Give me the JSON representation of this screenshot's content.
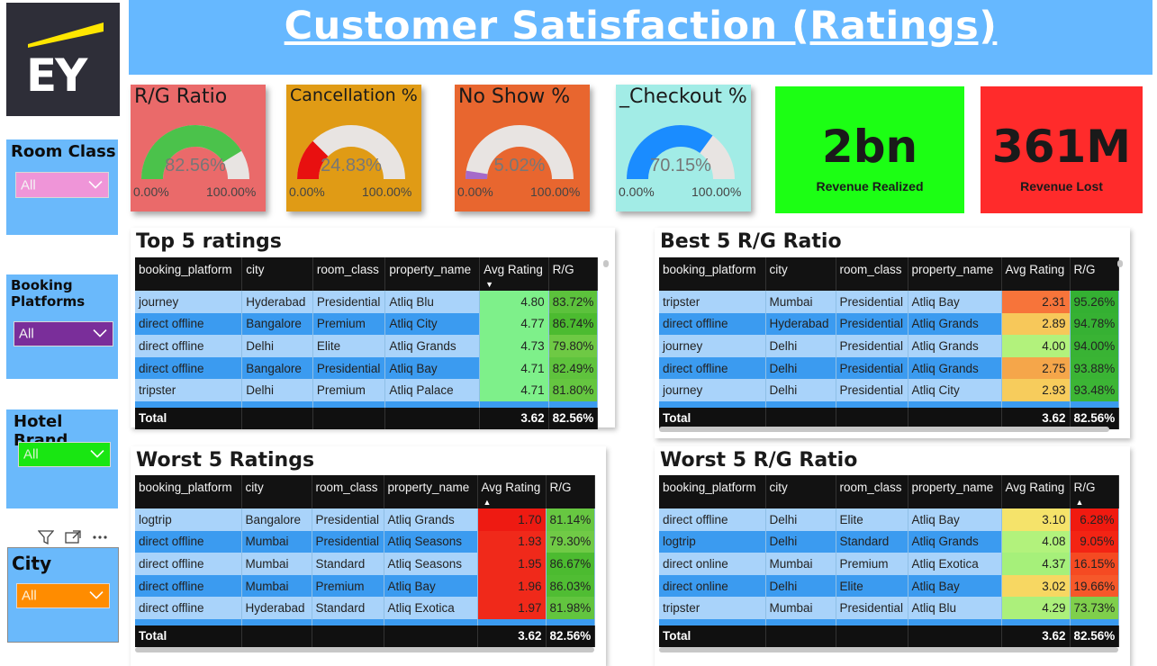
{
  "title": "Customer Satisfaction (Ratings)",
  "logo_text": "EY",
  "slicers": [
    {
      "title": "Room Class",
      "value": "All",
      "bg": "#ef95d8"
    },
    {
      "title": "Booking Platforms",
      "value": "All",
      "bg": "#7a2e9a"
    },
    {
      "title": "Hotel Brand",
      "value": "All",
      "bg": "#19e612"
    },
    {
      "title": "City",
      "value": "All",
      "bg": "#ff8c00"
    }
  ],
  "visual_header_icons": [
    "filter-icon",
    "focus-mode-icon",
    "more-options-icon"
  ],
  "kpis": [
    {
      "title": "R/G Ratio",
      "value": "82.56%",
      "fraction": 0.8256,
      "min": "0.00%",
      "max": "100.00%",
      "bg": "#ea6a6a",
      "fill": "#4bc24b"
    },
    {
      "title": "Cancellation %",
      "value": "24.83%",
      "fraction": 0.2483,
      "min": "0.00%",
      "max": "100.00%",
      "bg": "#e09b15",
      "fill": "#e81010"
    },
    {
      "title": "No Show %",
      "value": "5.02%",
      "fraction": 0.0502,
      "min": "0.00%",
      "max": "100.00%",
      "bg": "#e8662f",
      "fill": "#a56ac9"
    },
    {
      "title": "_Checkout %",
      "value": "70.15%",
      "fraction": 0.7015,
      "min": "0.00%",
      "max": "100.00%",
      "bg": "#a2ece6",
      "fill": "#1a8cff"
    }
  ],
  "cards": [
    {
      "value": "2bn",
      "label": "Revenue Realized",
      "bg": "#1cff14"
    },
    {
      "value": "361M",
      "label": "Revenue Lost",
      "bg": "#ff2b2b"
    }
  ],
  "columns": [
    "booking_platform",
    "city",
    "room_class",
    "property_name",
    "Avg Rating",
    "R/G"
  ],
  "tables": {
    "top5": {
      "title": "Top 5 ratings",
      "sort_col": 4,
      "sort_dir": "desc",
      "rows": [
        [
          "journey",
          "Hyderabad",
          "Presidential",
          "Atliq Blu",
          "4.80",
          "83.72%"
        ],
        [
          "direct offline",
          "Bangalore",
          "Premium",
          "Atliq City",
          "4.77",
          "86.74%"
        ],
        [
          "direct offline",
          "Delhi",
          "Elite",
          "Atliq Grands",
          "4.73",
          "79.80%"
        ],
        [
          "direct offline",
          "Bangalore",
          "Presidential",
          "Atliq Bay",
          "4.71",
          "82.49%"
        ],
        [
          "tripster",
          "Delhi",
          "Premium",
          "Atliq Palace",
          "4.71",
          "81.80%"
        ]
      ],
      "rating_colors": [
        "#7ef08a",
        "#7ef08a",
        "#7ef08a",
        "#7ef08a",
        "#7ef08a"
      ],
      "rg_colors": [
        "#5cc23c",
        "#4cbb30",
        "#6ec944",
        "#5fc33d",
        "#65c640"
      ],
      "total": [
        "Total",
        "",
        "",
        "",
        "3.62",
        "82.56%"
      ]
    },
    "best5": {
      "title": "Best 5 R/G Ratio",
      "sort_col": -1,
      "sort_dir": "",
      "rows": [
        [
          "tripster",
          "Mumbai",
          "Presidential",
          "Atliq Bay",
          "2.31",
          "95.26%"
        ],
        [
          "direct offline",
          "Hyderabad",
          "Presidential",
          "Atliq Grands",
          "2.89",
          "94.78%"
        ],
        [
          "journey",
          "Delhi",
          "Presidential",
          "Atliq Grands",
          "4.00",
          "94.00%"
        ],
        [
          "direct offline",
          "Delhi",
          "Presidential",
          "Atliq Grands",
          "2.75",
          "93.88%"
        ],
        [
          "journey",
          "Delhi",
          "Presidential",
          "Atliq City",
          "2.93",
          "93.48%"
        ]
      ],
      "rating_colors": [
        "#f7743a",
        "#f7c85a",
        "#b2f27c",
        "#f5a64a",
        "#f7cc5c"
      ],
      "rg_colors": [
        "#34b032",
        "#36b133",
        "#39b334",
        "#3ab434",
        "#3cb535"
      ],
      "total": [
        "Total",
        "",
        "",
        "",
        "3.62",
        "82.56%"
      ]
    },
    "worst5": {
      "title": "Worst 5 Ratings",
      "sort_col": 4,
      "sort_dir": "asc",
      "rows": [
        [
          "logtrip",
          "Bangalore",
          "Presidential",
          "Atliq Grands",
          "1.70",
          "81.14%"
        ],
        [
          "direct offline",
          "Mumbai",
          "Presidential",
          "Atliq Seasons",
          "1.93",
          "79.30%"
        ],
        [
          "direct offline",
          "Mumbai",
          "Standard",
          "Atliq Seasons",
          "1.95",
          "86.67%"
        ],
        [
          "direct offline",
          "Mumbai",
          "Premium",
          "Atliq Bay",
          "1.96",
          "86.03%"
        ],
        [
          "direct offline",
          "Hyderabad",
          "Standard",
          "Atliq Exotica",
          "1.97",
          "81.98%"
        ]
      ],
      "rating_colors": [
        "#ee1a12",
        "#f0291a",
        "#f0291a",
        "#f0291a",
        "#f0291a"
      ],
      "rg_colors": [
        "#67c741",
        "#70ca46",
        "#4cbb30",
        "#50bd33",
        "#62c53f"
      ],
      "total": [
        "Total",
        "",
        "",
        "",
        "3.62",
        "82.56%"
      ]
    },
    "worst5rg": {
      "title": "Worst 5 R/G Ratio",
      "sort_col": 5,
      "sort_dir": "asc",
      "rows": [
        [
          "direct offline",
          "Delhi",
          "Elite",
          "Atliq Bay",
          "3.10",
          "6.28%"
        ],
        [
          "logtrip",
          "Delhi",
          "Standard",
          "Atliq Grands",
          "4.08",
          "9.05%"
        ],
        [
          "direct online",
          "Mumbai",
          "Premium",
          "Atliq Exotica",
          "4.37",
          "16.15%"
        ],
        [
          "direct online",
          "Delhi",
          "Elite",
          "Atliq Bay",
          "3.02",
          "19.66%"
        ],
        [
          "tripster",
          "Mumbai",
          "Presidential",
          "Atliq Blu",
          "4.29",
          "73.73%"
        ]
      ],
      "rating_colors": [
        "#f5e36a",
        "#b2f27c",
        "#a6f07a",
        "#f7d762",
        "#acf07b"
      ],
      "rg_colors": [
        "#f01a10",
        "#f32414",
        "#f54a22",
        "#f6582a",
        "#7fcf4c"
      ],
      "total": [
        "Total",
        "",
        "",
        "",
        "3.62",
        "82.56%"
      ]
    }
  }
}
